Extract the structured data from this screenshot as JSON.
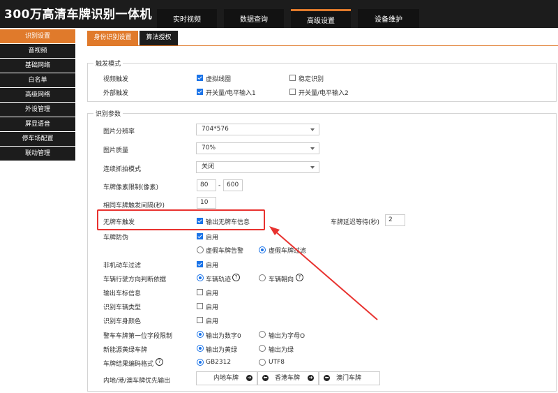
{
  "header": {
    "title": "300万高清车牌识别一体机",
    "nav": [
      "实时视频",
      "数据查询",
      "高级设置",
      "设备维护"
    ],
    "active_nav": "高级设置"
  },
  "sidebar": {
    "items": [
      "识别设置",
      "音视频",
      "基础网络",
      "白名单",
      "高级网络",
      "外设管理",
      "屏显语音",
      "停车场配置",
      "联动管理"
    ],
    "active": "识别设置"
  },
  "subtabs": [
    "身份识别设置",
    "算法授权"
  ],
  "trigger_mode": {
    "title": "触发模式",
    "video_trigger_label": "视频触发",
    "virtual_coil_label": "虚拟线圈",
    "virtual_coil_checked": true,
    "stable_recog_label": "稳定识别",
    "stable_recog_checked": false,
    "external_trigger_label": "外部触发",
    "switch_input1_label": "开关量/电平输入1",
    "switch_input1_checked": true,
    "switch_input2_label": "开关量/电平输入2",
    "switch_input2_checked": false
  },
  "recog_params": {
    "title": "识别参数",
    "resolution_label": "图片分辨率",
    "resolution_value": "704*576",
    "quality_label": "图片质量",
    "quality_value": "70%",
    "burst_label": "连续抓拍模式",
    "burst_value": "关闭",
    "pixel_limit_label": "车牌像素限制(像素)",
    "pixel_min": "80",
    "pixel_sep": "-",
    "pixel_max": "600",
    "same_plate_label": "相同车牌触发间隔(秒)",
    "same_plate_value": "10",
    "no_plate_trigger_label": "无牌车触发",
    "no_plate_output_label": "输出无牌车信息",
    "no_plate_output_checked": true,
    "plate_delay_label": "车牌延迟等待(秒)",
    "plate_delay_value": "2",
    "anti_fake_label": "车牌防伪",
    "enable_label": "启用",
    "anti_fake_checked": true,
    "fake_alarm_label": "虚假车牌告警",
    "fake_filter_label": "虚假车牌过滤",
    "non_motor_filter_label": "非机动车过滤",
    "non_motor_checked": true,
    "direction_label": "车辆行驶方向判断依据",
    "direction_track_label": "车辆轨迹",
    "direction_heading_label": "车辆朝向",
    "output_logo_label": "输出车标信息",
    "recog_type_label": "识别车辆类型",
    "recog_color_label": "识别车身颜色",
    "police_first_label": "警车车牌第一位字段限制",
    "output_digit_label": "输出为数字0",
    "output_letter_label": "输出为字母O",
    "new_energy_label": "新能源黄绿车牌",
    "output_yellowgreen_label": "输出为黄绿",
    "output_green_label": "输出为绿",
    "encoding_label": "车牌结果编码格式",
    "enc_gb_label": "GB2312",
    "enc_utf_label": "UTF8",
    "priority_label": "内地/港/澳车牌优先输出",
    "priority_mainland": "内地车牌",
    "priority_hk": "香港车牌",
    "priority_macau": "澳门车牌"
  },
  "colors": {
    "accent": "#e07a2b",
    "header_bg": "#1c1c1c",
    "check_blue": "#1a73e8",
    "highlight_red": "#e8322f"
  },
  "icons": [
    "help-circle-icon",
    "arrow-right-icon",
    "arrow-left-icon",
    "caret-down-icon"
  ]
}
